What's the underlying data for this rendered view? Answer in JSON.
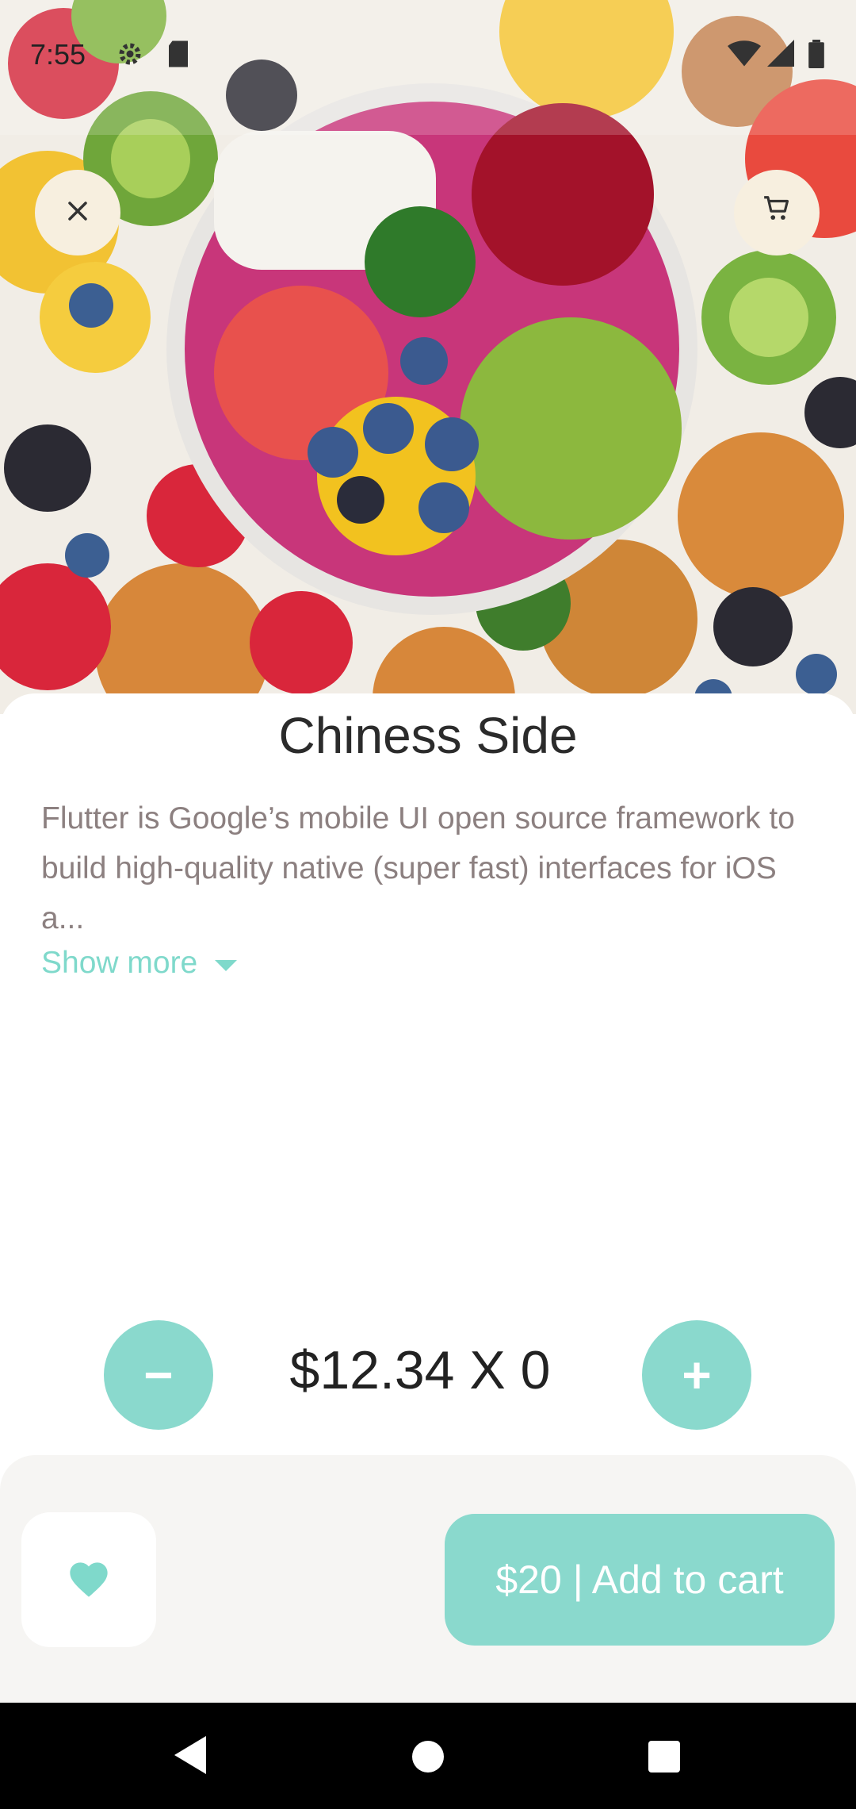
{
  "status_bar": {
    "time": "7:55"
  },
  "product": {
    "title": "Chiness Side",
    "description": "Flutter is Google’s mobile UI open source framework to build high-quality native (super fast) interfaces for iOS a...",
    "show_more_label": "Show more"
  },
  "quantity": {
    "price_line": "$12.34 X 0",
    "minus_label": "−",
    "plus_label": "+"
  },
  "actions": {
    "add_to_cart_label": "$20 | Add to cart"
  },
  "colors": {
    "accent": "#8ad9cd",
    "link": "#7fd9cb",
    "round_button_bg": "#f7efdf"
  },
  "icons": [
    "close-icon",
    "cart-icon",
    "heart-icon",
    "settings-icon",
    "sd-card-icon",
    "wifi-icon",
    "signal-icon",
    "battery-icon"
  ]
}
